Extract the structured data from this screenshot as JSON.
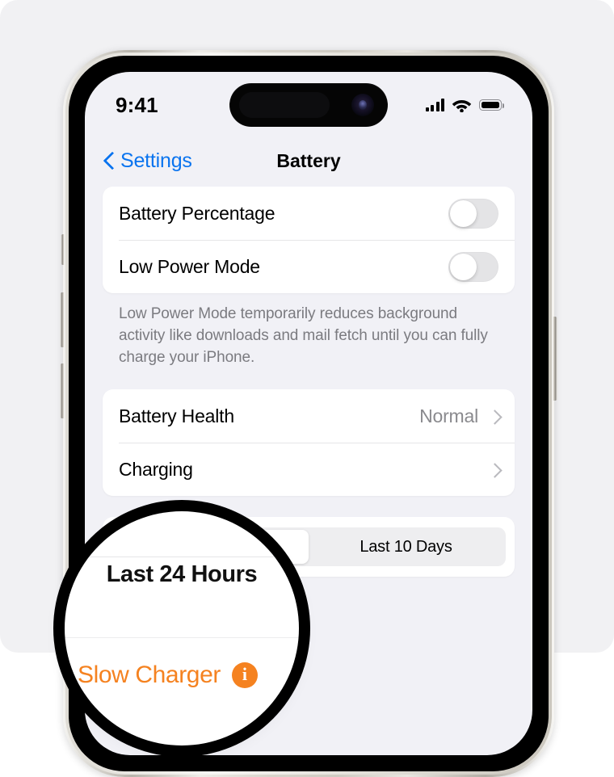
{
  "status_bar": {
    "time": "9:41",
    "icons": [
      "cellular-signal-icon",
      "wifi-icon",
      "battery-icon"
    ]
  },
  "nav": {
    "back_label": "Settings",
    "title": "Battery",
    "back_icon": "chevron-left-icon"
  },
  "sections": {
    "toggles": [
      {
        "label": "Battery Percentage",
        "state": "off"
      },
      {
        "label": "Low Power Mode",
        "state": "off"
      }
    ],
    "footnote": "Low Power Mode temporarily reduces background activity like downloads and mail fetch until you can fully charge your iPhone.",
    "links": [
      {
        "label": "Battery Health",
        "value": "Normal",
        "accessory": "chevron-right-icon"
      },
      {
        "label": "Charging",
        "value": "",
        "accessory": "chevron-right-icon"
      }
    ]
  },
  "usage": {
    "segments": [
      {
        "label": "Last 24 Hours",
        "selected": true
      },
      {
        "label": "Last 10 Days",
        "selected": false
      }
    ]
  },
  "magnifier": {
    "segment_label": "Last 24 Hours",
    "slow_charger_label": "Slow Charger",
    "info_glyph": "i",
    "info_icon_name": "info-badge-icon"
  },
  "colors": {
    "accent_blue": "#0a74ef",
    "warning_orange": "#f58220",
    "screen_bg": "#f1f1f6",
    "panel_bg": "#f1f1f3",
    "card_bg": "#ffffff",
    "secondary_text": "#8a8a8e"
  }
}
